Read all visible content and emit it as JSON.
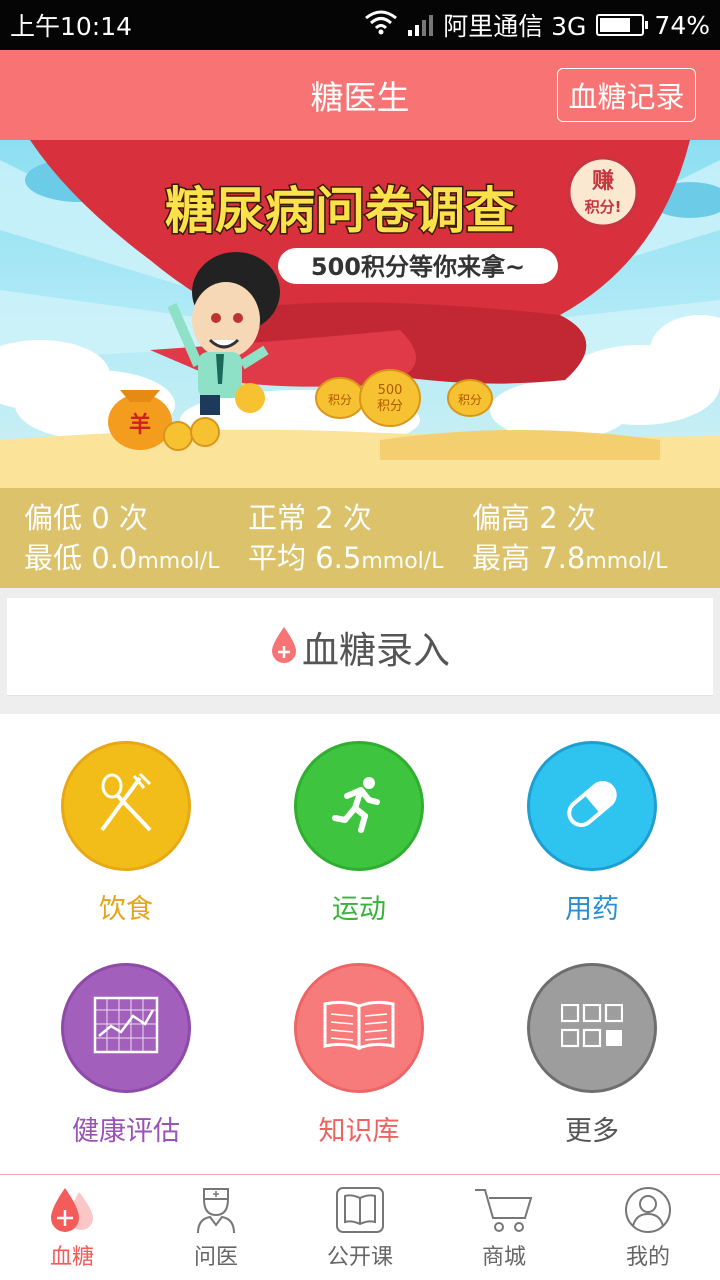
{
  "status_bar": {
    "time": "上午10:14",
    "carrier": "阿里通信 3G",
    "battery": "74%"
  },
  "header": {
    "title": "糖医生",
    "record_button": "血糖记录"
  },
  "banner": {
    "title": "糖尿病问卷调查",
    "subtitle": "500积分等你来拿~",
    "badge_line1": "赚",
    "badge_line2": "积分!",
    "coin_text_1": "积分",
    "coin_text_2a": "500",
    "coin_text_2b": "积分",
    "coin_text_3": "积分",
    "bag_text": "羊"
  },
  "stats": [
    {
      "line1": "偏低 0 次",
      "line2_value": "最低 0.0",
      "line2_unit": "mmol/L"
    },
    {
      "line1": "正常 2 次",
      "line2_value": "平均 6.5",
      "line2_unit": "mmol/L"
    },
    {
      "line1": "偏高 2 次",
      "line2_value": "最高 7.8",
      "line2_unit": "mmol/L"
    }
  ],
  "entry": {
    "label": "血糖录入"
  },
  "features": [
    {
      "label": "饮食",
      "color": "#f2bd19",
      "label_color": "#e7a31c",
      "icon": "fork-spoon-icon"
    },
    {
      "label": "运动",
      "color": "#3fc43f",
      "label_color": "#36b536",
      "icon": "running-icon"
    },
    {
      "label": "用药",
      "color": "#2ec4ef",
      "label_color": "#2a8fd0",
      "icon": "pill-icon"
    },
    {
      "label": "健康评估",
      "color": "#a25fbb",
      "label_color": "#9a52b5",
      "icon": "chart-icon"
    },
    {
      "label": "知识库",
      "color": "#f87b7b",
      "label_color": "#f06262",
      "icon": "book-icon"
    },
    {
      "label": "更多",
      "color": "#9d9d9d",
      "label_color": "#555555",
      "icon": "grid-icon"
    }
  ],
  "tabs": [
    {
      "label": "血糖",
      "icon": "blood-drop-icon",
      "active": true
    },
    {
      "label": "问医",
      "icon": "doctor-icon",
      "active": false
    },
    {
      "label": "公开课",
      "icon": "book-icon",
      "active": false
    },
    {
      "label": "商城",
      "icon": "cart-icon",
      "active": false
    },
    {
      "label": "我的",
      "icon": "user-icon",
      "active": false
    }
  ],
  "colors": {
    "accent": "#f87474",
    "stats_bg": "#dcc26a",
    "status_bar": "#050505"
  }
}
